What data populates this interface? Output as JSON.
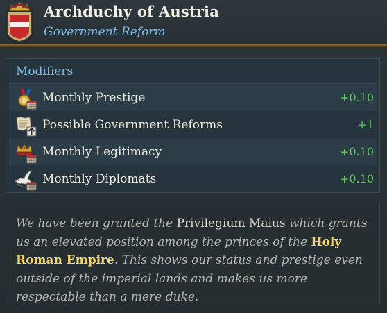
{
  "header": {
    "title": "Archduchy of Austria",
    "subtitle": "Government Reform"
  },
  "modifiers": {
    "heading": "Modifiers",
    "items": [
      {
        "icon": "prestige-medal-icon",
        "label": "Monthly Prestige",
        "value": "+0.10"
      },
      {
        "icon": "government-reform-scroll-icon",
        "label": "Possible Government Reforms",
        "value": "+1"
      },
      {
        "icon": "legitimacy-crown-icon",
        "label": "Monthly Legitimacy",
        "value": "+0.10"
      },
      {
        "icon": "diplomat-dove-icon",
        "label": "Monthly Diplomats",
        "value": "+0.10"
      }
    ]
  },
  "description": {
    "part1": "We have been granted the ",
    "part2": "Privilegium Maius",
    "part3": " which grants us an elevated position among the princes of the ",
    "highlight": "Holy Roman Empire",
    "part4": ". This shows our status and prestige even outside of the imperial lands and makes us more respectable than a mere duke."
  },
  "colors": {
    "title": "#f2eee2",
    "subtitle": "#7fbde8",
    "positive_value": "#5fd15f",
    "highlight": "#f3d56a"
  }
}
